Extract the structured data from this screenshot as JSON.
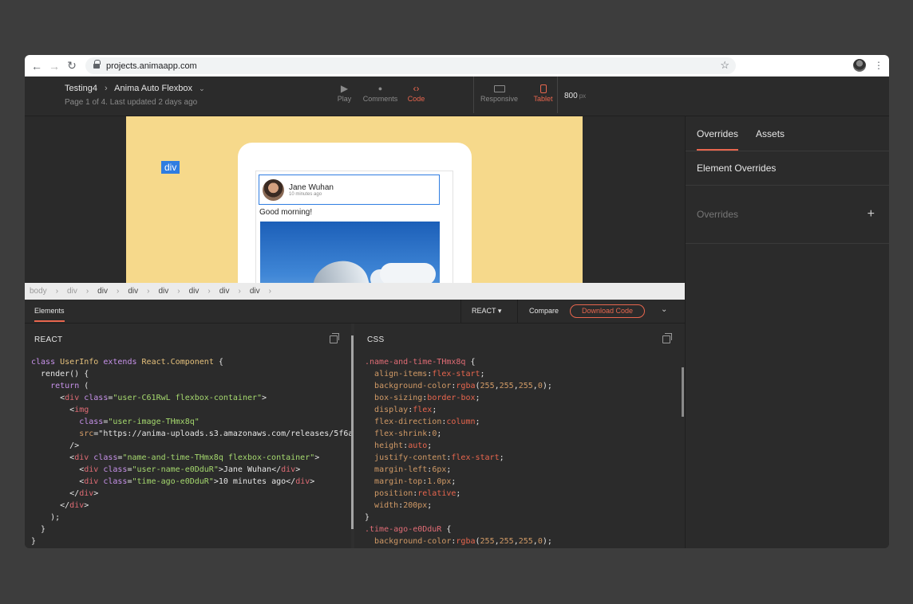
{
  "browser": {
    "url": "projects.animaapp.com",
    "back": "←",
    "forward": "→",
    "reload": "↻",
    "star": "☆",
    "menu": "⋮"
  },
  "header": {
    "project": "Testing4",
    "separator": "›",
    "page": "Anima Auto Flexbox",
    "caret": "⌄",
    "subtitle": "Page 1 of 4. Last updated 2 days ago",
    "modes": [
      {
        "label": "Play",
        "icon": "play-icon",
        "glyph": "▶"
      },
      {
        "label": "Comments",
        "icon": "comment-icon",
        "glyph": "●"
      },
      {
        "label": "Code",
        "icon": "code-icon",
        "glyph": "‹›"
      }
    ],
    "devices": [
      {
        "label": "Responsive",
        "icon": "laptop-icon"
      },
      {
        "label": "Tablet",
        "icon": "tablet-icon"
      }
    ],
    "width_value": "800",
    "width_unit": "px"
  },
  "preview": {
    "tag": "div",
    "user_name": "Jane Wuhan",
    "time_ago": "10 minutes ago",
    "post_text": "Good morning!"
  },
  "breadcrumb": [
    "body",
    "div",
    "div",
    "div",
    "div",
    "div",
    "div",
    "div"
  ],
  "breadcrumb_sep": "›",
  "right_panel": {
    "tabs": [
      "Overrides",
      "Assets"
    ],
    "section_title": "Element Overrides",
    "overrides_label": "Overrides",
    "plus": "+"
  },
  "code_toolbar": {
    "elements_tab": "Elements",
    "framework": "REACT ▾",
    "compare": "Compare",
    "download": "Download Code",
    "collapse": "⌄"
  },
  "react_pane": {
    "title": "REACT",
    "lines": [
      "class UserInfo extends React.Component {",
      "  render() {",
      "    return (",
      "      <div class=\"user-C61RwL flexbox-container\">",
      "        <img",
      "          class=\"user-image-THmx8q\"",
      "          src=\"https://anima-uploads.s3.amazonaws.com/releases/5f6a",
      "        />",
      "        <div class=\"name-and-time-THmx8q flexbox-container\">",
      "          <div class=\"user-name-e0DduR\">Jane Wuhan</div>",
      "          <div class=\"time-ago-e0DduR\">10 minutes ago</div>",
      "        </div>",
      "      </div>",
      "    );",
      "  }",
      "}"
    ]
  },
  "css_pane": {
    "title": "CSS",
    "lines": [
      ".name-and-time-THmx8q {",
      "  align-items:flex-start;",
      "  background-color:rgba(255,255,255,0);",
      "  box-sizing:border-box;",
      "  display:flex;",
      "  flex-direction:column;",
      "  flex-shrink:0;",
      "  height:auto;",
      "  justify-content:flex-start;",
      "  margin-left:6px;",
      "  margin-top:1.0px;",
      "  position:relative;",
      "  width:200px;",
      "}",
      ".time-ago-e0DduR {",
      "  background-color:rgba(255,255,255,0);"
    ]
  },
  "colors": {
    "accent": "#e8664e",
    "selection": "#2f7de1",
    "artboard": "#f6d98b",
    "panel": "#2b2b2b"
  }
}
